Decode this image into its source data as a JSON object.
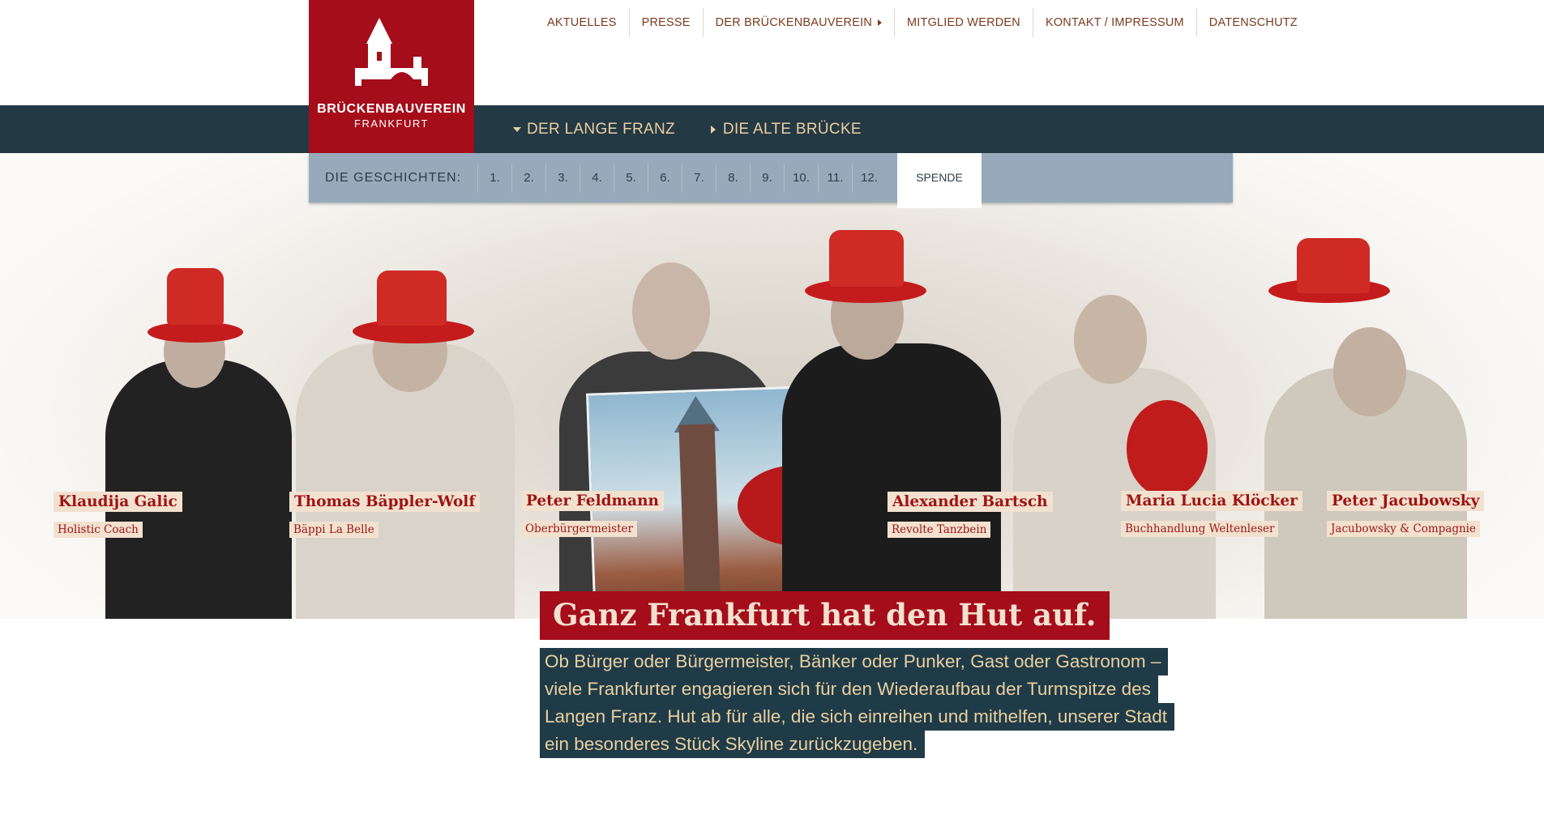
{
  "header": {
    "logo": {
      "line1": "BRÜCKENBAUVEREIN",
      "line2": "FRANKFURT"
    },
    "top_nav": [
      {
        "label": "AKTUELLES"
      },
      {
        "label": "PRESSE"
      },
      {
        "label": "DER BRÜCKENBAUVEREIN"
      },
      {
        "label": "MITGLIED WERDEN"
      },
      {
        "label": "KONTAKT / IMPRESSUM"
      },
      {
        "label": "DATENSCHUTZ"
      }
    ],
    "sub_nav": [
      {
        "label": "DER LANGE FRANZ"
      },
      {
        "label": "DIE ALTE BRÜCKE"
      }
    ]
  },
  "stories": {
    "label": "DIE GESCHICHTEN:",
    "numbers": [
      "1.",
      "2.",
      "3.",
      "4.",
      "5.",
      "6.",
      "7.",
      "8.",
      "9.",
      "10.",
      "11.",
      "12."
    ],
    "spende": "SPENDE"
  },
  "people": [
    {
      "name": "Klaudija Galic",
      "role": "Holistic Coach"
    },
    {
      "name": "Thomas Bäppler-Wolf",
      "role": "Bäppi La Belle"
    },
    {
      "name": "Peter Feldmann",
      "role": "Oberbürgermeister"
    },
    {
      "name": "Alexander Bartsch",
      "role": "Revolte Tanzbein"
    },
    {
      "name": "Maria Lucia Klöcker",
      "role": "Buchhandlung Weltenleser"
    },
    {
      "name": "Peter Jacubowsky",
      "role": "Jacubowsky & Compagnie"
    }
  ],
  "content": {
    "headline": "Ganz Frankfurt hat den Hut auf.",
    "lead_lines": [
      "Ob Bürger oder Bürgermeister, Bänker oder Punker, Gast oder Gastronom –",
      "viele Frankfurter engagieren sich für den Wiederaufbau der Turmspitze des",
      "Langen Franz. Hut ab für alle, die sich einreihen und mithelfen, unserer Stadt",
      "ein besonderes Stück Skyline zurückzugeben."
    ]
  },
  "colors": {
    "brand_red": "#a50d1a",
    "nav_dark": "#233944",
    "stories_bar": "#96aabb",
    "gold_text": "#e9cfa0",
    "label_bg": "#f2e1cf"
  }
}
